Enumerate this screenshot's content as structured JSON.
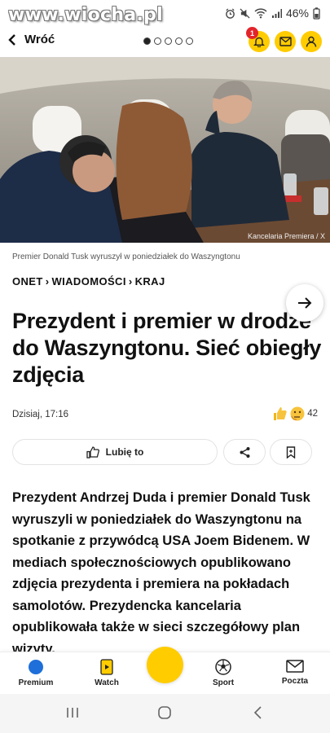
{
  "status_bar": {
    "watermark": "www.wiocha.pl",
    "battery": "46%",
    "icons": [
      "alarm-icon",
      "mute-icon",
      "wifi-icon",
      "signal-icon",
      "battery-icon"
    ]
  },
  "nav": {
    "back_label": "Wróć",
    "pager_total": 5,
    "pager_active": 1,
    "notification_count": "1",
    "icons": [
      "bell-icon",
      "mail-icon",
      "user-icon"
    ]
  },
  "article": {
    "photo_credit": "Kancelaria Premiera / X",
    "caption": "Premier Donald Tusk wyruszył w poniedziałek do Waszyngtonu",
    "breadcrumb": [
      "ONET",
      "WIADOMOŚCI",
      "KRAJ"
    ],
    "breadcrumb_sep": "›",
    "title": "Prezydent i premier w drodze do Waszyngtonu. Sieć obiegły zdjęcia",
    "date": "Dzisiaj, 17:16",
    "reactions_count": "42",
    "like_label": "Lubię to",
    "lead": "Prezydent Andrzej Duda i premier Donald Tusk wyruszyli w poniedziałek do Waszyngtonu na spotkanie z przywódcą USA Joem Bidenem. W mediach społecznościowych opublikowano zdjęcia prezydenta i premiera na pokładach samolotów. Prezydencka kancelaria opublikowała także w sieci szczegółowy plan wizyty."
  },
  "tabbar": {
    "premium": "Premium",
    "watch": "Watch",
    "sport": "Sport",
    "poczta": "Poczta"
  },
  "colors": {
    "accent": "#FFCC00",
    "badge": "#E3242B",
    "text": "#111111"
  }
}
